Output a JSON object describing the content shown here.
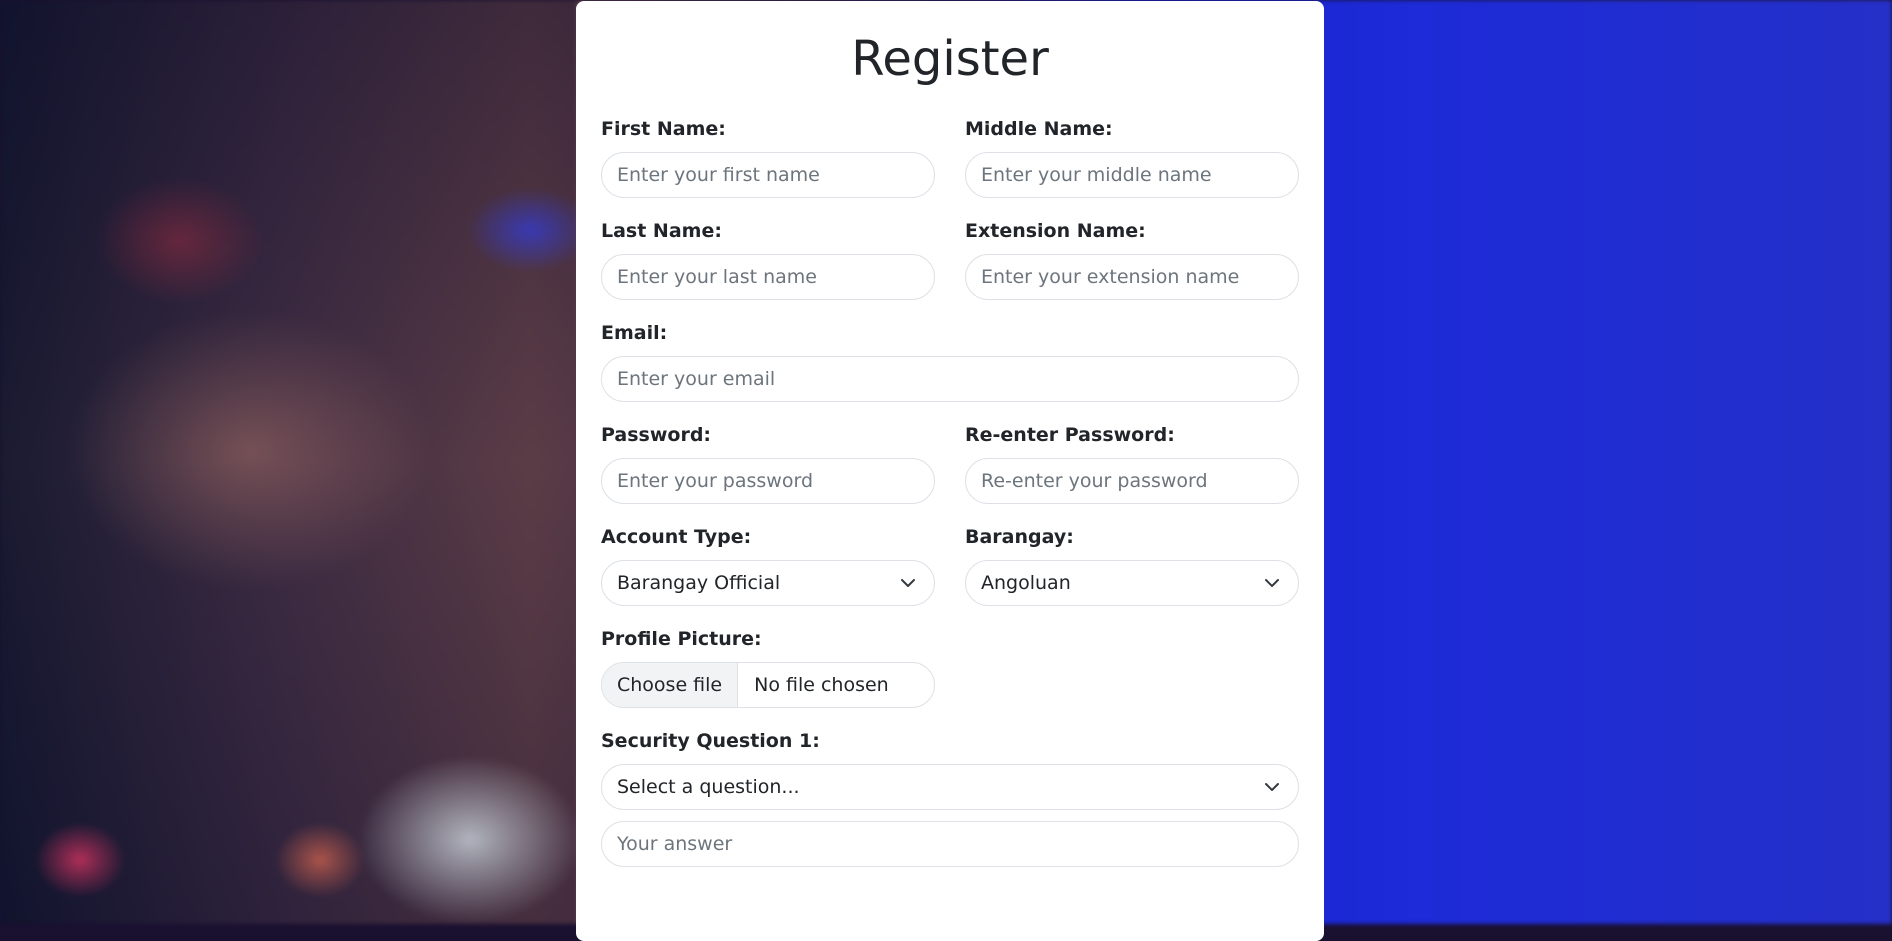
{
  "form": {
    "title": "Register",
    "first_name": {
      "label": "First Name:",
      "placeholder": "Enter your first name"
    },
    "middle_name": {
      "label": "Middle Name:",
      "placeholder": "Enter your middle name"
    },
    "last_name": {
      "label": "Last Name:",
      "placeholder": "Enter your last name"
    },
    "extension_name": {
      "label": "Extension Name:",
      "placeholder": "Enter your extension name"
    },
    "email": {
      "label": "Email:",
      "placeholder": "Enter your email"
    },
    "password": {
      "label": "Password:",
      "placeholder": "Enter your password"
    },
    "reenter_password": {
      "label": "Re-enter Password:",
      "placeholder": "Re-enter your password"
    },
    "account_type": {
      "label": "Account Type:",
      "value": "Barangay Official"
    },
    "barangay": {
      "label": "Barangay:",
      "value": "Angoluan"
    },
    "profile_picture": {
      "label": "Profile Picture:",
      "button": "Choose file",
      "status": "No file chosen"
    },
    "security_question_1": {
      "label": "Security Question 1:",
      "value": "Select a question...",
      "answer_placeholder": "Your answer"
    }
  },
  "icons": {
    "select_arrow": "chevron-down-icon"
  }
}
